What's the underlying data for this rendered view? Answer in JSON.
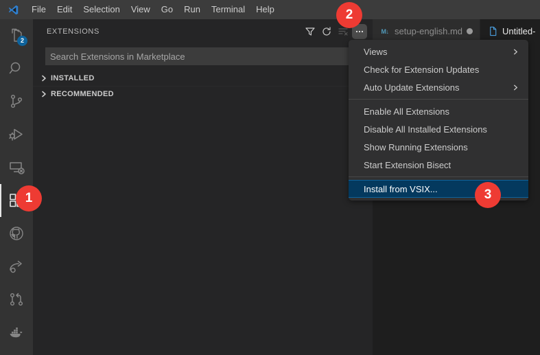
{
  "window": {
    "titlebar": {
      "logo_icon": "vscode-logo-icon",
      "menus": [
        {
          "label": "File"
        },
        {
          "label": "Edit"
        },
        {
          "label": "Selection"
        },
        {
          "label": "View"
        },
        {
          "label": "Go"
        },
        {
          "label": "Run"
        },
        {
          "label": "Terminal"
        },
        {
          "label": "Help"
        }
      ]
    }
  },
  "activity_bar": {
    "items": [
      {
        "name": "explorer",
        "icon": "files-icon",
        "active": false,
        "badge": "2"
      },
      {
        "name": "search",
        "icon": "search-icon",
        "active": false,
        "badge": ""
      },
      {
        "name": "source-control",
        "icon": "source-control-icon",
        "active": false,
        "badge": ""
      },
      {
        "name": "run-and-debug",
        "icon": "run-debug-icon",
        "active": false,
        "badge": ""
      },
      {
        "name": "remote-explorer",
        "icon": "remote-explorer-icon",
        "active": false,
        "badge": ""
      },
      {
        "name": "extensions",
        "icon": "extensions-icon",
        "active": true,
        "badge": ""
      },
      {
        "name": "github",
        "icon": "github-icon",
        "active": false,
        "badge": ""
      },
      {
        "name": "live-share",
        "icon": "live-share-icon",
        "active": false,
        "badge": ""
      },
      {
        "name": "pull-requests",
        "icon": "pull-request-icon",
        "active": false,
        "badge": ""
      },
      {
        "name": "docker",
        "icon": "docker-icon",
        "active": false,
        "badge": ""
      }
    ]
  },
  "sidebar": {
    "title": "EXTENSIONS",
    "actions": [
      {
        "name": "filter",
        "icon": "filter-icon",
        "state": "enabled"
      },
      {
        "name": "refresh",
        "icon": "refresh-icon",
        "state": "enabled"
      },
      {
        "name": "clear-search-results",
        "icon": "clear-search-icon",
        "state": "disabled"
      },
      {
        "name": "more-actions",
        "icon": "ellipsis-icon",
        "state": "pressed"
      }
    ],
    "search": {
      "value": "",
      "placeholder": "Search Extensions in Marketplace"
    },
    "sections": [
      {
        "label": "INSTALLED",
        "expanded": false
      },
      {
        "label": "RECOMMENDED",
        "expanded": false
      }
    ]
  },
  "editor": {
    "tabs": [
      {
        "label": "setup-english.md",
        "icon": "markdown-icon",
        "active": false,
        "dirty": true
      },
      {
        "label": "Untitled-",
        "icon": "file-icon",
        "active": true,
        "dirty": false
      }
    ]
  },
  "context_menu": {
    "items": [
      {
        "label": "Views",
        "submenu": true,
        "selected": false,
        "separator_after": false
      },
      {
        "label": "Check for Extension Updates",
        "submenu": false,
        "selected": false,
        "separator_after": false
      },
      {
        "label": "Auto Update Extensions",
        "submenu": true,
        "selected": false,
        "separator_after": true
      },
      {
        "label": "Enable All Extensions",
        "submenu": false,
        "selected": false,
        "separator_after": false
      },
      {
        "label": "Disable All Installed Extensions",
        "submenu": false,
        "selected": false,
        "separator_after": false
      },
      {
        "label": "Show Running Extensions",
        "submenu": false,
        "selected": false,
        "separator_after": false
      },
      {
        "label": "Start Extension Bisect",
        "submenu": false,
        "selected": false,
        "separator_after": true
      },
      {
        "label": "Install from VSIX...",
        "submenu": false,
        "selected": true,
        "separator_after": false
      }
    ]
  },
  "annotations": [
    {
      "number": "1",
      "target": "extensions-activity-bar-icon"
    },
    {
      "number": "2",
      "target": "extensions-more-actions-button"
    },
    {
      "number": "3",
      "target": "install-from-vsix-menu-item"
    }
  ],
  "colors": {
    "titlebar_bg": "#3c3c3c",
    "activitybar_bg": "#333333",
    "sidebar_bg": "#252526",
    "editor_bg": "#1e1e1e",
    "menu_bg": "#303031",
    "selection_bg": "#04395e",
    "selection_border": "#0e639c",
    "badge_bg": "#0e639c",
    "annotation_bg": "#ee3b33",
    "text": "#cccccc"
  }
}
